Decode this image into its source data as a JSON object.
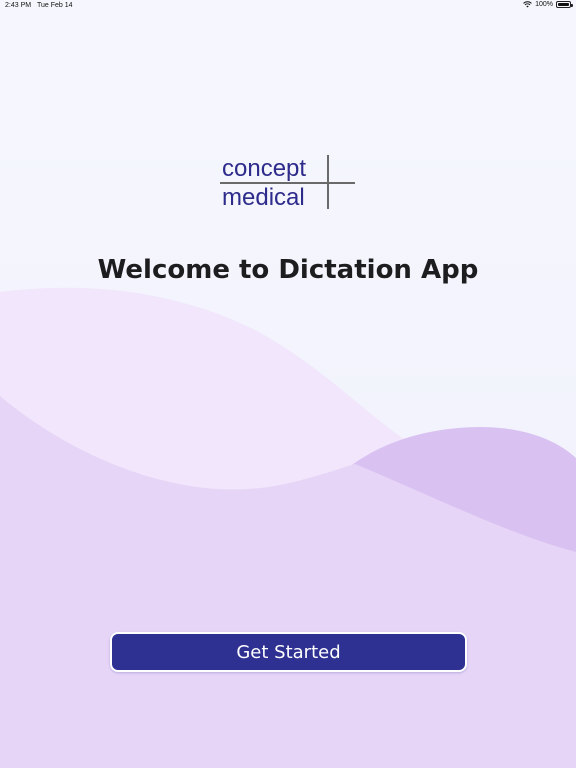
{
  "status_bar": {
    "time": "2:43 PM",
    "date": "Tue Feb 14",
    "battery": "100%",
    "icons": [
      "wifi-icon",
      "battery-icon"
    ]
  },
  "logo": {
    "line1": "concept",
    "line2": "medical",
    "color": "#2d2b8b"
  },
  "welcome": {
    "title": "Welcome to Dictation App"
  },
  "actions": {
    "get_started_label": "Get Started"
  },
  "colors": {
    "primary": "#2e3192",
    "background": "#f4f5fd",
    "wave_light": "#ead9f8",
    "wave_dark": "#d7bff1"
  }
}
